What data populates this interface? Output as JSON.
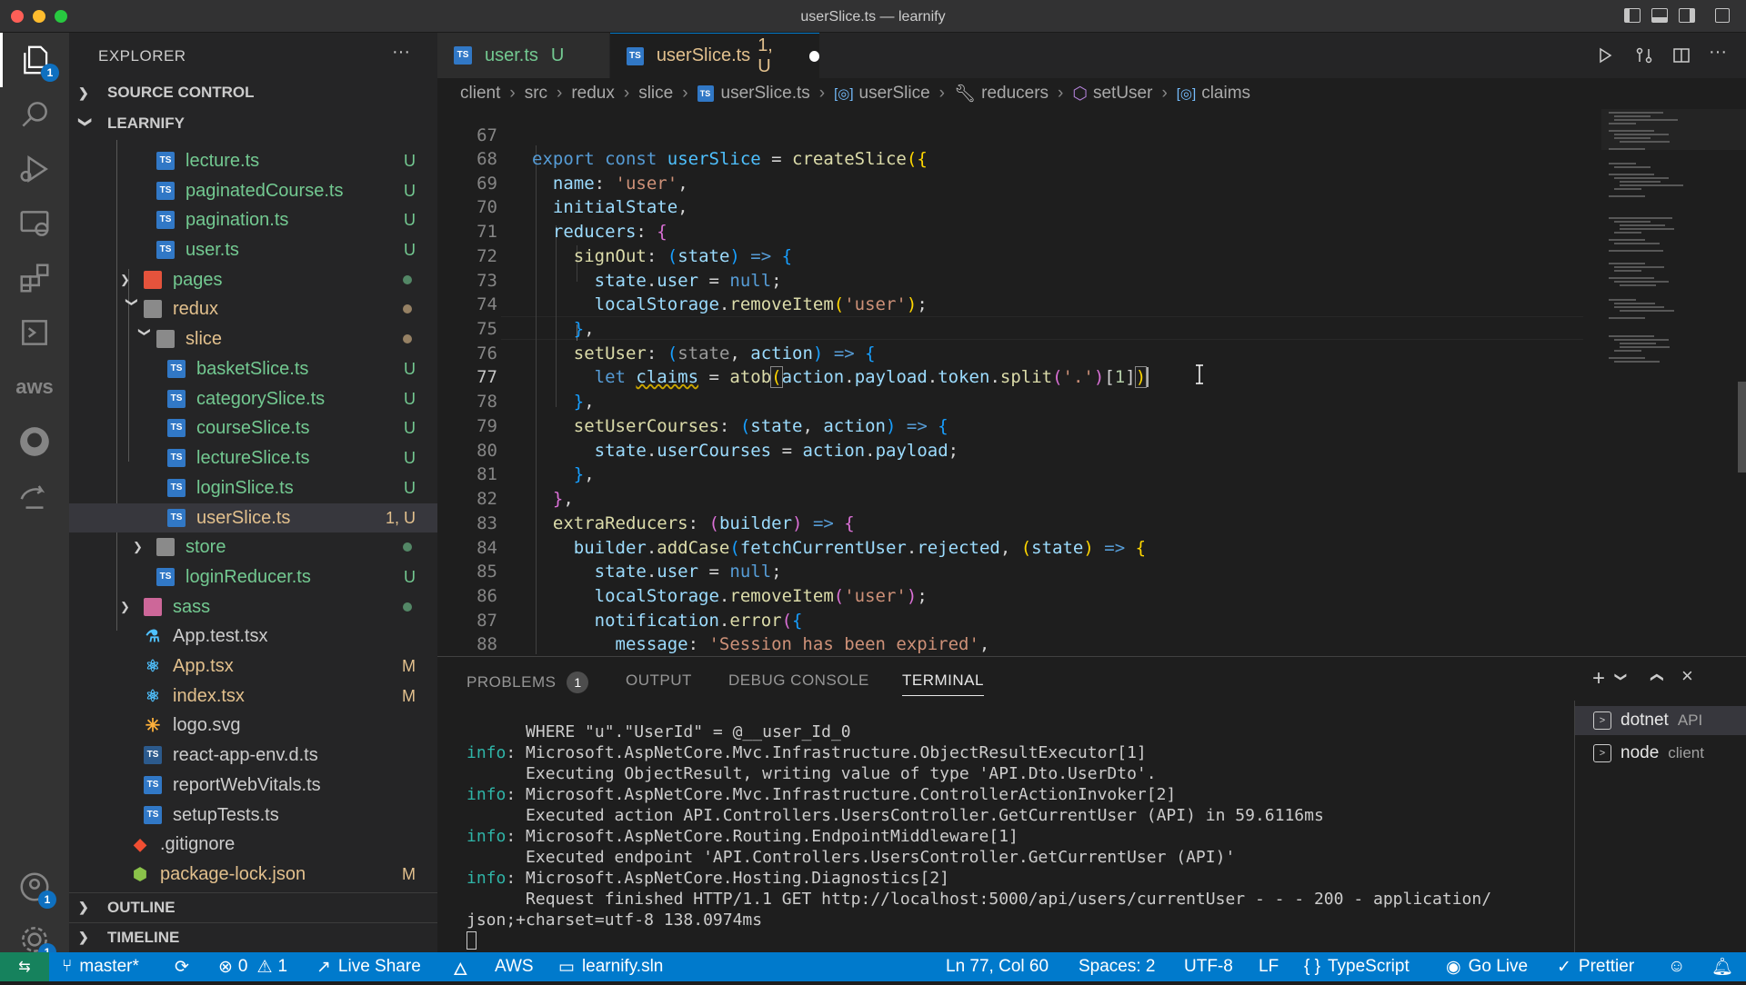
{
  "window": {
    "title": "userSlice.ts — learnify"
  },
  "activity_bar": {
    "items": [
      "explorer-icon",
      "search-icon",
      "run-debug-icon",
      "remote-explorer-icon",
      "extensions-icon",
      "terminal-icon",
      "aws-icon",
      "github-icon",
      "live-share-icon"
    ],
    "explorer_badge": "1",
    "aws_label": "aws",
    "accounts_badge": "1",
    "settings_badge": "1"
  },
  "sidebar": {
    "title": "EXPLORER",
    "more_label": "···",
    "source_control": "SOURCE CONTROL",
    "project": "LEARNIFY",
    "files": [
      {
        "name": "lecture.ts",
        "status": "U"
      },
      {
        "name": "paginatedCourse.ts",
        "status": "U"
      },
      {
        "name": "pagination.ts",
        "status": "U"
      },
      {
        "name": "user.ts",
        "status": "U"
      },
      {
        "name": "pages",
        "status": ""
      },
      {
        "name": "redux",
        "status": ""
      },
      {
        "name": "slice",
        "status": ""
      },
      {
        "name": "basketSlice.ts",
        "status": "U"
      },
      {
        "name": "categorySlice.ts",
        "status": "U"
      },
      {
        "name": "courseSlice.ts",
        "status": "U"
      },
      {
        "name": "lectureSlice.ts",
        "status": "U"
      },
      {
        "name": "loginSlice.ts",
        "status": "U"
      },
      {
        "name": "userSlice.ts",
        "status": "1, U"
      },
      {
        "name": "store",
        "status": ""
      },
      {
        "name": "loginReducer.ts",
        "status": "U"
      },
      {
        "name": "sass",
        "status": ""
      },
      {
        "name": "App.test.tsx",
        "status": ""
      },
      {
        "name": "App.tsx",
        "status": "M"
      },
      {
        "name": "index.tsx",
        "status": "M"
      },
      {
        "name": "logo.svg",
        "status": ""
      },
      {
        "name": "react-app-env.d.ts",
        "status": ""
      },
      {
        "name": "reportWebVitals.ts",
        "status": ""
      },
      {
        "name": "setupTests.ts",
        "status": ""
      },
      {
        "name": ".gitignore",
        "status": ""
      },
      {
        "name": "package-lock.json",
        "status": "M"
      }
    ],
    "outline": "OUTLINE",
    "timeline": "TIMELINE"
  },
  "tabs": [
    {
      "label": "user.ts",
      "status": "U"
    },
    {
      "label": "userSlice.ts",
      "status": "1, U"
    }
  ],
  "breadcrumb": [
    "client",
    "src",
    "redux",
    "slice",
    "userSlice.ts",
    "userSlice",
    "reducers",
    "setUser",
    "claims"
  ],
  "code": {
    "line_numbers": [
      "67",
      "68",
      "69",
      "70",
      "71",
      "72",
      "73",
      "74",
      "75",
      "76",
      "77",
      "78",
      "79",
      "80",
      "81",
      "82",
      "83",
      "84",
      "85",
      "86",
      "87",
      "88"
    ],
    "current_line": "77"
  },
  "panel": {
    "tabs": [
      "PROBLEMS",
      "OUTPUT",
      "DEBUG CONSOLE",
      "TERMINAL"
    ],
    "problems_count": "1",
    "terminal_lines": [
      {
        "prefix": "",
        "text": "      WHERE \"u\".\"UserId\" = @__user_Id_0"
      },
      {
        "prefix": "info",
        "text": ": Microsoft.AspNetCore.Mvc.Infrastructure.ObjectResultExecutor[1]"
      },
      {
        "prefix": "",
        "text": "      Executing ObjectResult, writing value of type 'API.Dto.UserDto'."
      },
      {
        "prefix": "info",
        "text": ": Microsoft.AspNetCore.Mvc.Infrastructure.ControllerActionInvoker[2]"
      },
      {
        "prefix": "",
        "text": "      Executed action API.Controllers.UsersController.GetCurrentUser (API) in 59.6116ms"
      },
      {
        "prefix": "info",
        "text": ": Microsoft.AspNetCore.Routing.EndpointMiddleware[1]"
      },
      {
        "prefix": "",
        "text": "      Executed endpoint 'API.Controllers.UsersController.GetCurrentUser (API)'"
      },
      {
        "prefix": "info",
        "text": ": Microsoft.AspNetCore.Hosting.Diagnostics[2]"
      },
      {
        "prefix": "",
        "text": "      Request finished HTTP/1.1 GET http://localhost:5000/api/users/currentUser - - - 200 - application/"
      },
      {
        "prefix": "",
        "text": "json;+charset=utf-8 138.0974ms"
      }
    ],
    "terminals": [
      {
        "name": "dotnet",
        "folder": "API"
      },
      {
        "name": "node",
        "folder": "client"
      }
    ]
  },
  "status_bar": {
    "branch": "master*",
    "errors": "0",
    "warnings": "1",
    "live_share": "Live Share",
    "aws": "AWS",
    "solution": "learnify.sln",
    "position": "Ln 77, Col 60",
    "spaces": "Spaces: 2",
    "encoding": "UTF-8",
    "eol": "LF",
    "language": "TypeScript",
    "go_live": "Go Live",
    "prettier": "Prettier"
  },
  "colors": {
    "accent": "#007acc",
    "untracked": "#73c991",
    "modified": "#e2c08d",
    "error": "#f14c4c"
  }
}
